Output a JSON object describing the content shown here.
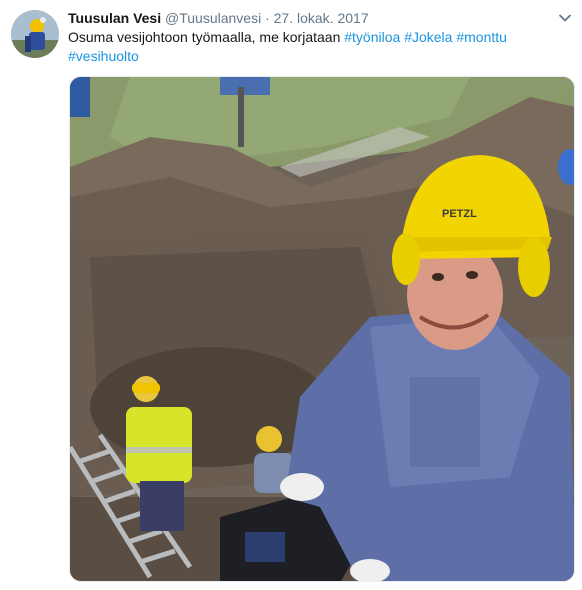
{
  "tweet": {
    "author_name": "Tuusulan Vesi",
    "handle": "@Tuusulanvesi",
    "separator": "·",
    "date": "27. lokak. 2017",
    "text": "Osuma vesijohtoon työmaalla, me korjataan",
    "hashtags": [
      "#työniloa",
      "#Jokela",
      "#monttu",
      "#vesihuolto"
    ],
    "media": {
      "alt_subject": "worker-photo",
      "helmet_brand": "PETZL"
    }
  },
  "icons": {
    "menu": "chevron-down-icon",
    "avatar": "avatar"
  }
}
